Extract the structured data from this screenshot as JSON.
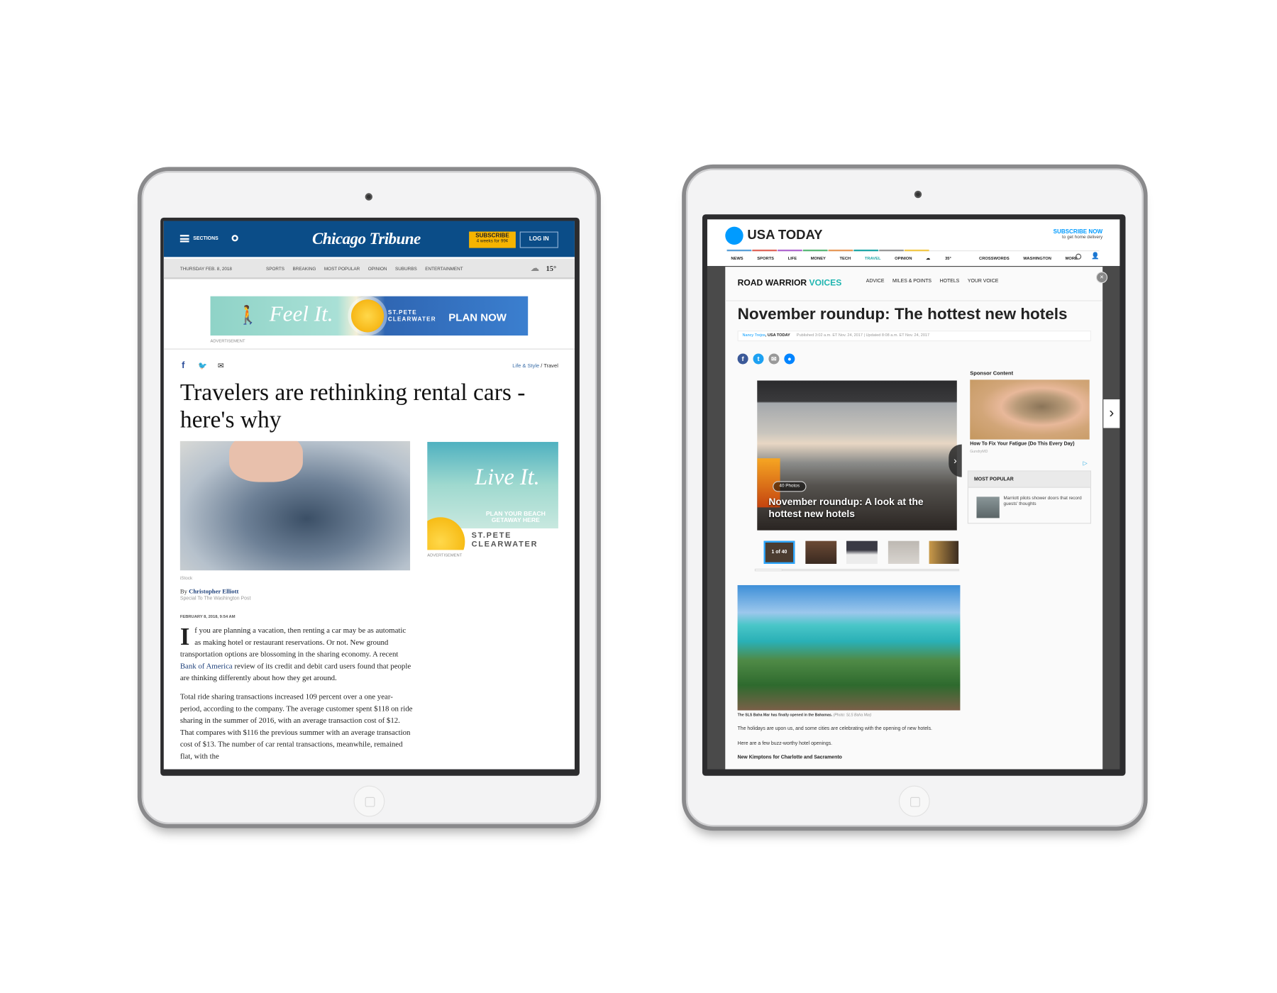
{
  "chicago_tribune": {
    "header": {
      "sections_label": "SECTIONS",
      "logo": "Chicago Tribune",
      "subscribe_label": "SUBSCRIBE",
      "subscribe_offer": "4 weeks for 99¢",
      "login_label": "LOG IN"
    },
    "subnav": {
      "date": "THURSDAY FEB. 8, 2018",
      "items": [
        "SPORTS",
        "BREAKING",
        "MOST POPULAR",
        "OPINION",
        "SUBURBS",
        "ENTERTAINMENT"
      ],
      "temperature": "15°"
    },
    "top_ad": {
      "tagline": "Feel It.",
      "brand_line1": "ST.PETE",
      "brand_line2": "CLEARWATER",
      "cta": "PLAN NOW",
      "label": "ADVERTISEMENT"
    },
    "breadcrumb": {
      "section": "Life & Style",
      "separator": " / ",
      "subsection": "Travel"
    },
    "headline": "Travelers are rethinking rental cars - here's why",
    "image_credit": "iStock",
    "byline": {
      "prefix": "By ",
      "author": "Christopher Elliott",
      "affiliation": "Special To The Washington Post"
    },
    "dateline": "FEBRUARY 8, 2018, 9:54 AM",
    "side_ad": {
      "tagline": "Live It.",
      "cta": "PLAN YOUR BEACH GETAWAY HERE",
      "brand_line1": "ST.PETE",
      "brand_line2": "CLEARWATER",
      "label": "ADVERTISEMENT"
    },
    "body": {
      "drop_cap": "I",
      "p1_a": "f you are planning a vacation, then renting a car may be as automatic as making hotel or restaurant reservations. Or not. New ground transportation options are blossoming in the sharing economy. A recent ",
      "p1_link": "Bank of America",
      "p1_b": " review of its credit and debit card users found that people are thinking differently about how they get around.",
      "p2": "Total ride sharing transactions increased 109 percent over a one year-period, according to the company. The average customer spent $118 on ride sharing in the summer of 2016, with an average transaction cost of $12. That compares with $116 the previous summer with an average transaction cost of $13. The number of car rental transactions, meanwhile, remained flat, with the"
    },
    "colors": {
      "header_blue": "#0b4d88",
      "subscribe_yellow": "#f6b400",
      "link_blue": "#1c3f7a"
    }
  },
  "usa_today": {
    "header": {
      "logo": "USA TODAY",
      "subscribe_label": "SUBSCRIBE NOW",
      "subscribe_sub": "to get home delivery"
    },
    "nav": [
      "NEWS",
      "SPORTS",
      "LIFE",
      "MONEY",
      "TECH",
      "TRAVEL",
      "OPINION",
      "35°",
      "CROSSWORDS",
      "WASHINGTON",
      "MORE"
    ],
    "nav_active": "TRAVEL",
    "section": {
      "brand_a": "ROAD WARRIOR ",
      "brand_b": "VOICES",
      "links": [
        "ADVICE",
        "MILES & POINTS",
        "HOTELS",
        "YOUR VOICE"
      ]
    },
    "headline": "November roundup: The hottest new hotels",
    "byline": {
      "author": "Nancy Trejos",
      "outlet": ", USA TODAY",
      "published": "Published 3:02 a.m. ET Nov. 24, 2017",
      "updated": " | Updated 8:08 a.m. ET Nov. 24, 2017"
    },
    "gallery": {
      "count_label": "40 Photos",
      "caption": "November roundup: A look at the hottest new hotels",
      "thumb_label": "1 of 40"
    },
    "sponsor": {
      "heading": "Sponsor Content",
      "title": "How To Fix Your Fatigue (Do This Every Day)",
      "source": "GundryMD"
    },
    "most_popular": {
      "heading": "MOST POPULAR",
      "items": [
        "Marriott pilots shower doors that record guests' thoughts"
      ]
    },
    "photo_caption": {
      "text": "The SLS Baha Mar has finally opened in the Bahamas. ",
      "credit": "(Photo: SLS Baha Mar)"
    },
    "body": {
      "p1": "The holidays are upon us, and some cities are celebrating with the opening of new hotels.",
      "p2": "Here are a few buzz-worthy hotel openings.",
      "subhead": "New Kimptons for Charlotte and Sacramento"
    },
    "colors": {
      "brand_blue": "#009bff",
      "voices_teal": "#1fb5b0",
      "nav_colors": [
        "#5aa0d8",
        "#e0675c",
        "#b06ad0",
        "#5cb87a",
        "#e69a5c",
        "#22a7a7",
        "#999999",
        "#f2c94c"
      ]
    }
  }
}
